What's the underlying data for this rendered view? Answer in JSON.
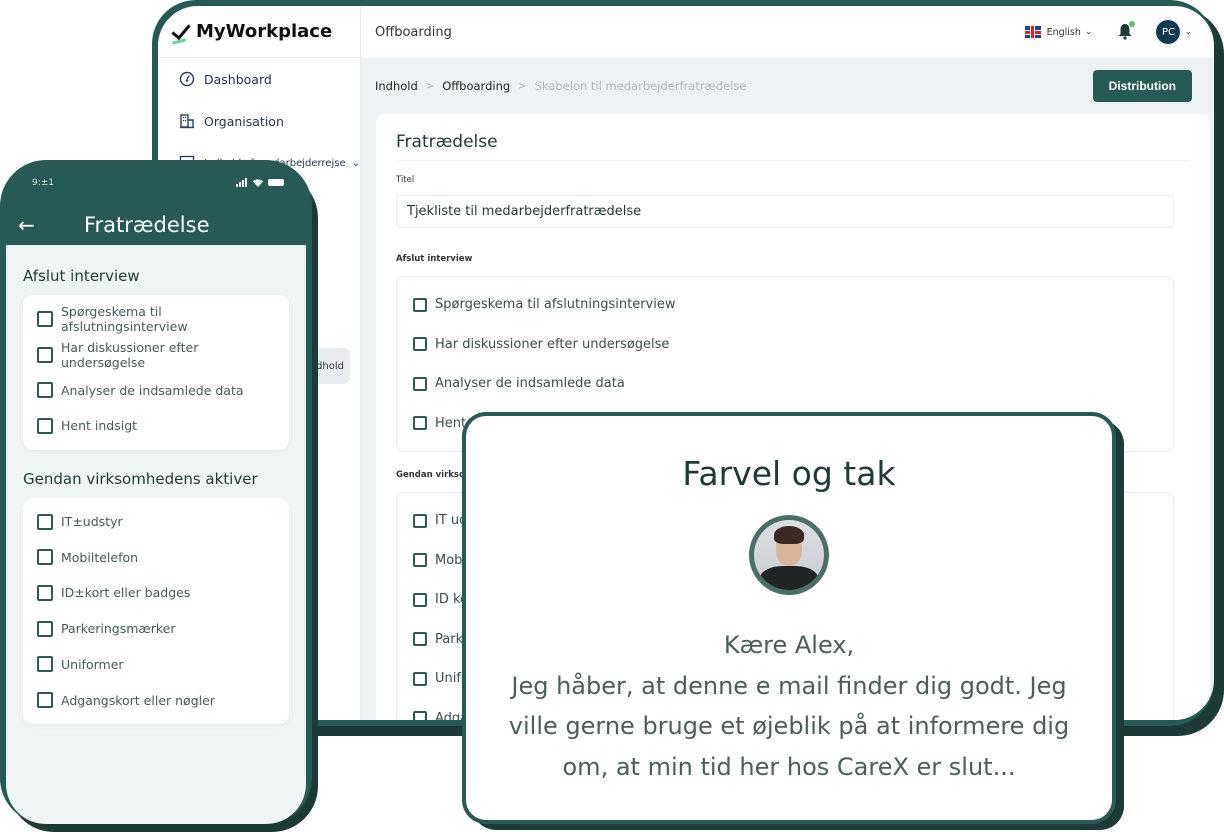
{
  "desktop": {
    "brand": "MyWorkplace",
    "sidebar": {
      "items": [
        {
          "label": "Dashboard",
          "icon": "dashboard-gauge-icon"
        },
        {
          "label": "Organisation",
          "icon": "building-icon"
        },
        {
          "label": "Indhold af medarbejderrejse",
          "icon": "layout-grid-icon",
          "has_chevron": true
        }
      ],
      "active_item_partial": "ndhold"
    },
    "topbar": {
      "page_title": "Offboarding",
      "language": "English",
      "user_initials": "PC",
      "notification_dot_color": "#5cc56a"
    },
    "breadcrumb": [
      "Indhold",
      "Offboarding",
      "Skabelon til medarbejderfratrædelse"
    ],
    "distribution_button": "Distribution",
    "form": {
      "heading": "Fratrædelse",
      "title_label": "Titel",
      "title_value": "Tjekliste til medarbejderfratrædelse",
      "sections": [
        {
          "label": "Afslut interview",
          "items": [
            "Spørgeskema til afslutningsinterview",
            "Har diskussioner efter undersøgelse",
            "Analyser de indsamlede data",
            "Hent indsigt"
          ]
        },
        {
          "label": "Gendan virksomhedens aktiver",
          "items": [
            "IT udstyr",
            "Mobiltelefon",
            "ID kort eller badges",
            "Parkeringsmærker",
            "Uniformer",
            "Adgangskort eller nøgler"
          ]
        }
      ]
    }
  },
  "phone": {
    "status_time": "9:±1",
    "title": "Fratrædelse",
    "sections": [
      {
        "label": "Afslut interview",
        "items": [
          "Spørgeskema til afslutningsinterview",
          "Har diskussioner efter undersøgelse",
          "Analyser de indsamlede data",
          "Hent indsigt"
        ]
      },
      {
        "label": "Gendan virksomhedens aktiver",
        "items": [
          "IT±udstyr",
          "Mobiltelefon",
          "ID±kort eller badges",
          "Parkeringsmærker",
          "Uniformer",
          "Adgangskort eller nøgler"
        ]
      }
    ]
  },
  "farewell": {
    "title": "Farvel og tak",
    "greeting": "Kære Alex,",
    "body": "Jeg håber, at denne e mail finder dig godt. Jeg ville gerne bruge et øjeblik på at informere dig om, at min tid her hos CareX er slut..."
  },
  "colors": {
    "brand_dark": "#275a54",
    "frame_shadow": "#1c3a36",
    "page_bg": "#eef2f4"
  }
}
